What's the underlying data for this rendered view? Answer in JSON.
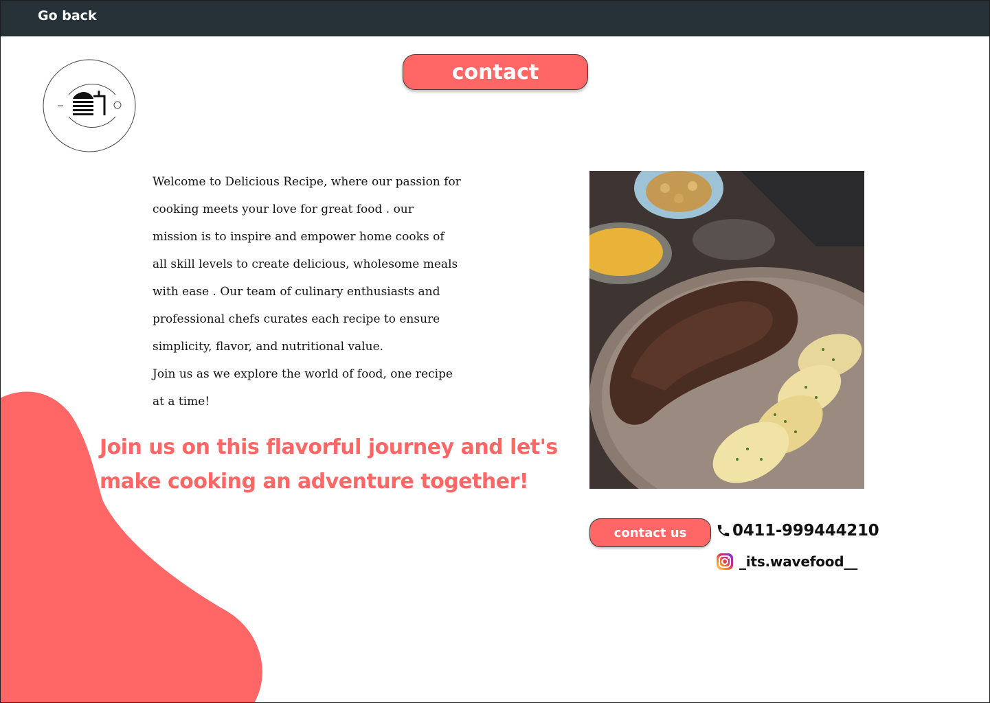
{
  "topbar": {
    "back_label": "Go back",
    "background": "#263238"
  },
  "header": {
    "contact_label": "contact"
  },
  "logo": {
    "icon": "food-plate-logo-icon"
  },
  "about": {
    "paragraph": "Welcome to Delicious Recipe, where our passion for\ncooking meets your love for great food . our\nmission is to inspire and empower home cooks of\nall skill levels to create delicious, wholesome meals\nwith ease . Our team of culinary enthusiasts and\nprofessional chefs curates each recipe to ensure\nsimplicity, flavor, and nutritional value.\n Join us as we explore the world of food, one recipe\nat a time!"
  },
  "tagline": {
    "text": "Join us on this flavorful journey and let's make cooking an adventure together!"
  },
  "photo": {
    "subject": "steak-with-potatoes-image"
  },
  "contact": {
    "button_label": "contact us",
    "phone": "0411-999444210",
    "instagram": "_its.wavefood__",
    "phone_icon": "phone-icon",
    "instagram_icon": "instagram-icon"
  },
  "colors": {
    "accent": "#ff6666",
    "dark": "#263238"
  }
}
